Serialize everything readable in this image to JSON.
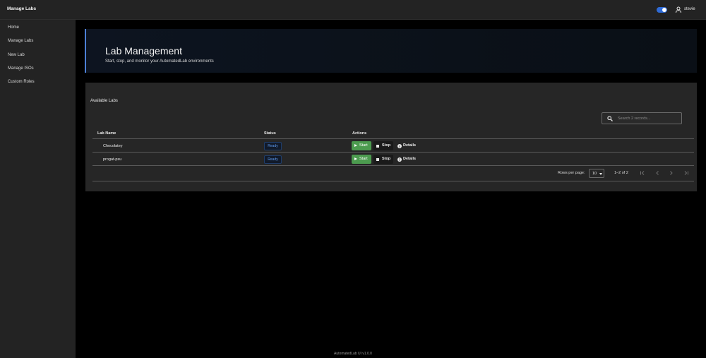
{
  "appbar": {
    "title": "Manage Labs",
    "theme_toggle": {
      "state": "on",
      "color": "#2f6bd6"
    },
    "user": {
      "icon": "user-icon",
      "name": "stevie"
    }
  },
  "sidebar": {
    "items": [
      {
        "label": "Home"
      },
      {
        "label": "Manage Labs"
      },
      {
        "label": "New Lab"
      },
      {
        "label": "Manage ISOs"
      },
      {
        "label": "Custom Roles"
      }
    ]
  },
  "hero": {
    "title": "Lab Management",
    "subtitle": "Start, stop, and monitor your AutomatedLab environments",
    "accent_color": "#4c7fd6"
  },
  "labs_card": {
    "title": "Available Labs",
    "search": {
      "placeholder": "Search 2 records...",
      "value": "",
      "icon": "search-icon"
    },
    "columns": [
      "Lab Name",
      "Status",
      "Actions"
    ],
    "rows": [
      {
        "name": "Chocolatey",
        "status": "Ready",
        "actions": {
          "start": "Start",
          "stop": "Stop",
          "details": "Details"
        }
      },
      {
        "name": "progat-psu",
        "status": "Ready",
        "actions": {
          "start": "Start",
          "stop": "Stop",
          "details": "Details"
        }
      }
    ],
    "pagination": {
      "rows_per_page_label": "Rows per page:",
      "rows_per_page_value": "10",
      "range": "1–2 of 2"
    },
    "colors": {
      "start_button": "#4c9b4f",
      "status_badge_text": "#5e9bf0"
    }
  },
  "footer": {
    "text": "AutomatedLab UI v1.0.0"
  }
}
